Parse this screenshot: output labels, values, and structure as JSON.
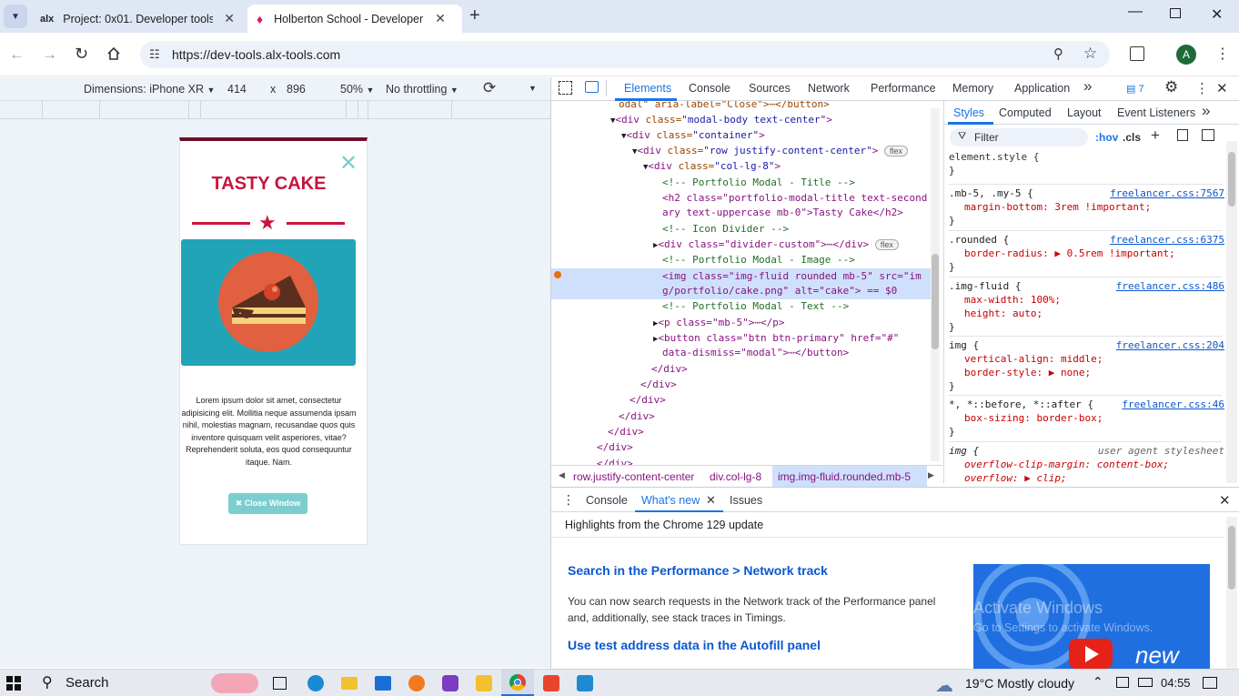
{
  "browser": {
    "tabs": [
      {
        "title": "Project: 0x01. Developer tools |",
        "favicon": "alx"
      },
      {
        "title": "Holberton School - Developer t",
        "active": true
      }
    ],
    "url": "https://dev-tools.alx-tools.com",
    "profile_initial": "A"
  },
  "device_toolbar": {
    "dimensions": "Dimensions: iPhone XR",
    "width": "414",
    "times": "x",
    "height": "896",
    "zoom": "50%",
    "throttle": "No throttling"
  },
  "page": {
    "title": "TASTY CAKE",
    "close": "✕",
    "body_lines": [
      "Lorem ipsum dolor sit amet, consectetur",
      "adipisicing elit. Mollitia neque assumenda ipsam",
      "nihil, molestias magnam, recusandae quos quis",
      "inventore quisquam velit asperiores, vitae?",
      "Reprehenderit soluta, eos quod consequuntur",
      "itaque. Nam."
    ],
    "button": "Close Window",
    "colors": {
      "accent": "#e2194b",
      "image_bg": "#21a4b8",
      "circle": "#e06040",
      "button": "#7ccdce"
    }
  },
  "devtools": {
    "tabs": [
      "Elements",
      "Console",
      "Sources",
      "Network",
      "Performance",
      "Memory",
      "Application"
    ],
    "more": "»",
    "issues_count": "7",
    "dom_lines": [
      {
        "i": 0,
        "arrow": "",
        "html": "odal\" aria-label=\"Close\">⋯</button>",
        "cls": "tag"
      },
      {
        "i": 1,
        "arrow": "▼",
        "tag": "<div",
        "attr": " class=",
        "val": "\"modal-body text-center\"",
        "end": ">"
      },
      {
        "i": 2,
        "arrow": "▼",
        "tag": "<div",
        "attr": " class=",
        "val": "\"container\"",
        "end": ">"
      },
      {
        "i": 3,
        "arrow": "▼",
        "tag": "<div",
        "attr": " class=",
        "val": "\"row justify-content-center\"",
        "end": ">",
        "badge": "flex"
      },
      {
        "i": 4,
        "arrow": "▼",
        "tag": "<div",
        "attr": " class=",
        "val": "\"col-lg-8\"",
        "end": ">"
      }
    ],
    "comment1": "<!-- Portfolio Modal - Title -->",
    "h2_a": "<h2 class=\"portfolio-modal-title text-second",
    "h2_b": "ary text-uppercase mb-0\">Tasty Cake</h2>",
    "comment2": "<!-- Icon Divider -->",
    "divider": "<div class=\"divider-custom\">⋯</div>",
    "comment3": "<!-- Portfolio Modal - Image -->",
    "img_a": "<img class=\"img-fluid rounded mb-5\" src=\"im",
    "img_b": "g/portfolio/cake.png\" alt=\"cake\"> == $0",
    "comment4": "<!-- Portfolio Modal - Text -->",
    "p_line": "<p class=\"mb-5\">⋯</p>",
    "btn_a": "<button class=\"btn btn-primary\" href=\"#\"",
    "btn_b": "data-dismiss=\"modal\">⋯</button>",
    "closers": [
      "</div>",
      "</div>",
      "</div>",
      "</div>",
      "</div>",
      "</div>",
      "</div>"
    ],
    "breadcrumb": [
      "row.justify-content-center",
      "div.col-lg-8",
      "img.img-fluid.rounded.mb-5"
    ],
    "styles_tabs": [
      "Styles",
      "Computed",
      "Layout",
      "Event Listeners"
    ],
    "filter_placeholder": "Filter",
    "hov": ":hov",
    "cls": ".cls",
    "rules": [
      {
        "sel": "element.style {",
        "src": "",
        "props": [],
        "end": "}"
      },
      {
        "sel": ".mb-5, .my-5 {",
        "src": "freelancer.css:7567",
        "props": [
          "margin-bottom: 3rem !important;"
        ],
        "end": "}"
      },
      {
        "sel": ".rounded {",
        "src": "freelancer.css:6375",
        "props": [
          "border-radius: ▶ 0.5rem !important;"
        ],
        "end": "}"
      },
      {
        "sel": ".img-fluid {",
        "src": "freelancer.css:486",
        "props": [
          "max-width: 100%;",
          "height: auto;"
        ],
        "end": "}"
      },
      {
        "sel": "img {",
        "src": "freelancer.css:204",
        "props": [
          "vertical-align: middle;",
          "border-style: ▶ none;"
        ],
        "end": "}"
      },
      {
        "sel": "*, *::before, *::after {",
        "src": "freelancer.css:46",
        "props": [
          "box-sizing: border-box;"
        ],
        "end": "}"
      },
      {
        "sel": "img {",
        "src": "user agent stylesheet",
        "props": [
          "overflow-clip-margin: content-box;",
          "overflow: ▶ clip;"
        ],
        "end": ""
      }
    ],
    "drawer_tabs": [
      "Console",
      "What's new",
      "Issues"
    ],
    "whats_new": {
      "highlights": "Highlights from the Chrome 129 update",
      "h1": "Search in the Performance > Network track",
      "p1a": "You can now search requests in the Network track of the Performance panel",
      "p1b": "and, additionally, see stack traces in Timings.",
      "h2": "Use test address data in the Autofill panel",
      "video_new": "new",
      "watermark1": "Activate Windows",
      "watermark2": "Go to Settings to activate Windows."
    }
  },
  "taskbar": {
    "search": "Search",
    "weather": "19°C  Mostly cloudy",
    "time": "04:55"
  }
}
